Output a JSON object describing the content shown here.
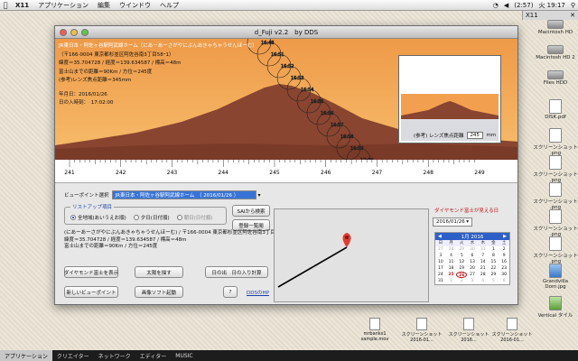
{
  "menubar": {
    "app": "X11",
    "items": [
      "アプリケーション",
      "編集",
      "ウインドウ",
      "ヘルプ"
    ],
    "battery": "(2:57)",
    "clock": "火 19:17",
    "right_app": "X11"
  },
  "desktop_icons": [
    {
      "label": "Macintosh HD"
    },
    {
      "label": "Macintosh HD 2"
    },
    {
      "label": "Files HDD"
    },
    {
      "label": "DISK.pdf"
    },
    {
      "label": "スクリーンショット .png"
    },
    {
      "label": "スクリーンショット .png"
    },
    {
      "label": "スクリーンショット .png"
    },
    {
      "label": "スクリーンショット .png"
    },
    {
      "label": "スクリーンショット .png"
    },
    {
      "label": "Grandvilla Dom.jpg"
    },
    {
      "label": "Vertical タイル"
    }
  ],
  "window": {
    "title": "d_Fuji v2.2　by DDS",
    "info": {
      "line1": "JR東日本・阿佐ヶ谷駅阿武線ホーム（にあ－あーさがやにぶんあきゃちゃうせんほーむ）",
      "line2": "（〒166-0004 東京都杉並区阿佐谷南3丁目58ｰ1）",
      "line3": "緯度＝35.704728 / 経度＝139.634587 / 標高＝48m",
      "line4": "富士山までの距離＝90Km / 方位＝245度",
      "line5": "(参考)レンズ焦点距離＝345mm",
      "date_label": "年月日：2016/01/26",
      "time_label": "日の入時刻：　17:02:00"
    },
    "sun_labels": [
      "16:48",
      "16:51",
      "16:52",
      "16:53",
      "16:54",
      "16:55",
      "16:56",
      "16:57",
      "16:58",
      "16:59",
      "17:00"
    ],
    "thumbnail": {
      "focal_label": "(参考) レンズ焦点距離",
      "focal_value": "245",
      "focal_unit": "mm"
    },
    "ruler_ticks": [
      "241",
      "242",
      "243",
      "244",
      "245",
      "246",
      "247",
      "248",
      "249"
    ],
    "viewpoint_label": "ビューポイント選択",
    "viewpoint_value": "JR東日本・阿佐ヶ谷駅阿武線ホーム　（ 2016/01/26 ）",
    "list_group_label": "リストアップ項目",
    "radios": [
      "全地域(あいうえお順)",
      "夕日(日付順)",
      "朝日(日付順)"
    ],
    "btn_list_search": "SAIから検索",
    "btn_register": "登録一覧閲",
    "detail_lines": [
      "(にあーあーさがやにぶんあきゃちゃうせんほーむ) / 〒166-0004 東京都杉並区阿佐谷南3丁目58-1",
      "緯度＝35.704728 / 経度＝139.634587 / 標高＝48m",
      "富士山までの距離＝90Km / 方位＝245度"
    ],
    "btn_diamond": "ダイヤモンド富士を表示",
    "btn_sun": "太陽を描す",
    "btn_sunset": "日の出　日の入り計算",
    "btn_new_vp": "新しいビューポイント",
    "btn_image_soft": "画像ソフト起動",
    "btn_help": "?",
    "link_dds": "DDSのHP",
    "calendar": {
      "title": "ダイヤモンド富士が見える日",
      "date_select": "2016/01/26",
      "month_label": "1月 2016",
      "day_headers": [
        "日",
        "月",
        "火",
        "水",
        "木",
        "金",
        "土"
      ],
      "weeks": [
        [
          "27",
          "28",
          "29",
          "30",
          "31",
          "1",
          "2"
        ],
        [
          "3",
          "4",
          "5",
          "6",
          "7",
          "8",
          "9"
        ],
        [
          "10",
          "11",
          "12",
          "13",
          "14",
          "15",
          "16"
        ],
        [
          "17",
          "18",
          "19",
          "20",
          "21",
          "22",
          "23"
        ],
        [
          "24",
          "25",
          "26",
          "27",
          "28",
          "29",
          "30"
        ],
        [
          "31",
          "1",
          "2",
          "3",
          "4",
          "5",
          "6"
        ]
      ]
    }
  },
  "bottom_files": [
    {
      "label": "mrbanks1 sample.mov"
    },
    {
      "label": "スクリーンショット 2016-01..."
    },
    {
      "label": "スクリーンショット 2016..."
    },
    {
      "label": "スクリーンショット 2016-01..."
    },
    {
      "label": "スクリーンショット 2016..."
    }
  ],
  "tabbar": [
    "アプリケーション",
    "クリエイター",
    "ネットワーク",
    "エディター",
    "MUSIC"
  ],
  "colors": {
    "sky_top": "#f0a050",
    "sky_bottom": "#f8c070",
    "mountain": "#8a4530"
  }
}
